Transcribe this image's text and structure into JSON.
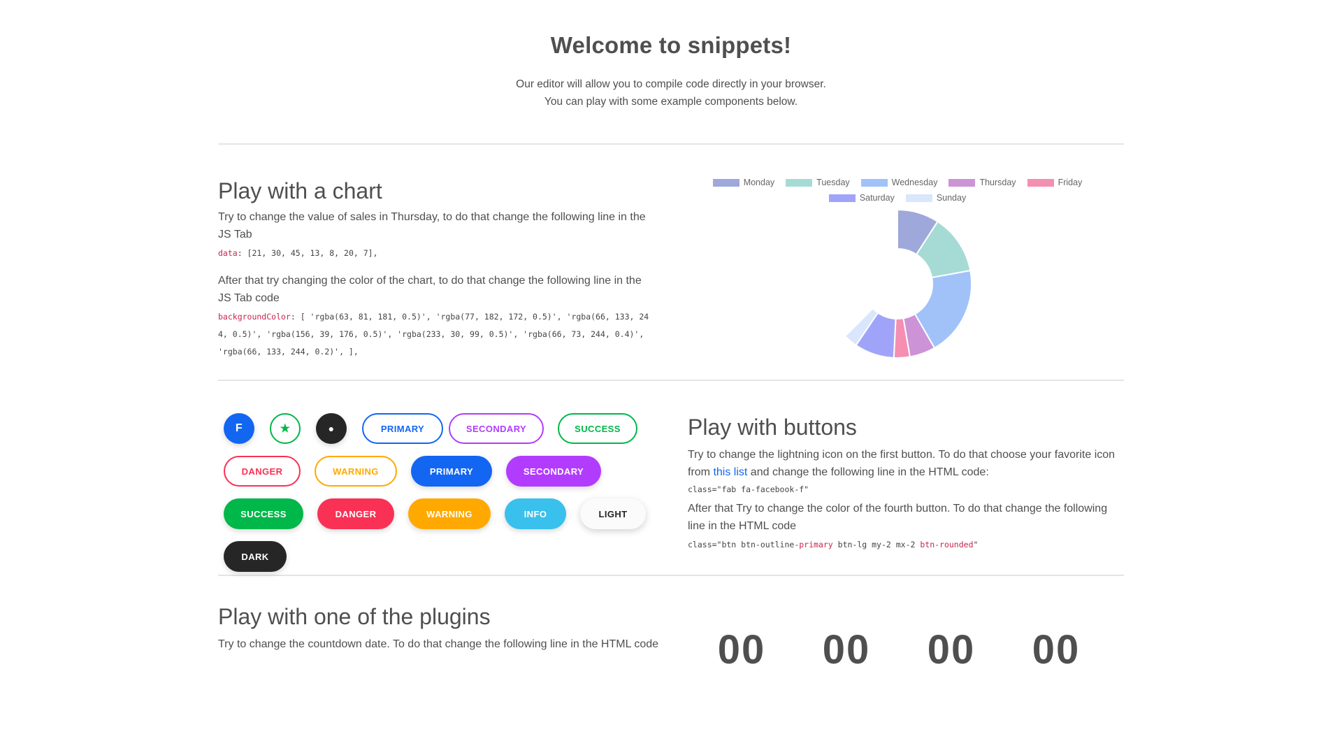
{
  "welcome": {
    "title": "Welcome to snippets!",
    "line1": "Our editor will allow you to compile code directly in your browser.",
    "line2": "You can play with some example components below."
  },
  "chart_section": {
    "title": "Play with a chart",
    "p1": "Try to change the value of sales in Thursday, to do that change the following line in the JS Tab",
    "code1_key": "data",
    "code1_rest": ": [21, 30, 45, 13, 8, 20, 7],",
    "p2": "After that try changing the color of the chart, to do that change the following line in the JS Tab code",
    "code2_key": "backgroundColor",
    "code2_rest": ": [ 'rgba(63, 81, 181, 0.5)', 'rgba(77, 182, 172, 0.5)', 'rgba(66, 133, 244, 0.5)', 'rgba(156, 39, 176, 0.5)', 'rgba(233, 30, 99, 0.5)', 'rgba(66, 73, 244, 0.4)', 'rgba(66, 133, 244, 0.2)', ],"
  },
  "chart_data": {
    "type": "pie",
    "variant": "half-doughnut",
    "legend_position": "top",
    "categories": [
      "Monday",
      "Tuesday",
      "Wednesday",
      "Thursday",
      "Friday",
      "Saturday",
      "Sunday"
    ],
    "values": [
      21,
      30,
      45,
      13,
      8,
      20,
      7
    ],
    "colors": [
      "#9fa8da",
      "#a6dbd5",
      "#a0c2f9",
      "#cd93d7",
      "#f48fb1",
      "#a0a4f9",
      "#d9e6fc"
    ]
  },
  "buttons_section": {
    "title": "Play with buttons",
    "p1_before": "Try to change the lightning icon on the first button. To do that choose your favorite icon from ",
    "p1_link": "this list",
    "p1_after": " and change the following line in the HTML code:",
    "code1": "class=\"fab fa-facebook-f\"",
    "p2": "After that Try to change the color of the fourth button. To do that change the following line in the HTML code",
    "code2_a": "class=\"btn btn-outline-",
    "code2_b": "primary",
    "code2_c": " btn-lg my-2 mx-2 ",
    "code2_d": "btn-rounded",
    "code2_e": "\""
  },
  "buttons": {
    "icon1": "f",
    "icon2": "★",
    "icon3": "●",
    "outline_primary": "PRIMARY",
    "outline_secondary": "SECONDARY",
    "outline_success": "SUCCESS",
    "outline_danger": "DANGER",
    "outline_warning": "WARNING",
    "primary": "PRIMARY",
    "secondary": "SECONDARY",
    "success": "SUCCESS",
    "danger": "DANGER",
    "warning": "WARNING",
    "info": "INFO",
    "light": "LIGHT",
    "dark": "DARK"
  },
  "colors": {
    "primary": "#1266f1",
    "secondary": "#b23cfd",
    "success": "#00b74a",
    "danger": "#f93154",
    "warning": "#ffa900",
    "info": "#39c0ed",
    "dark": "#262626"
  },
  "plugins_section": {
    "title": "Play with one of the plugins",
    "p1": "Try to change the countdown date. To do that change the following line in the HTML code"
  },
  "countdown": [
    "00",
    "00",
    "00",
    "00"
  ]
}
